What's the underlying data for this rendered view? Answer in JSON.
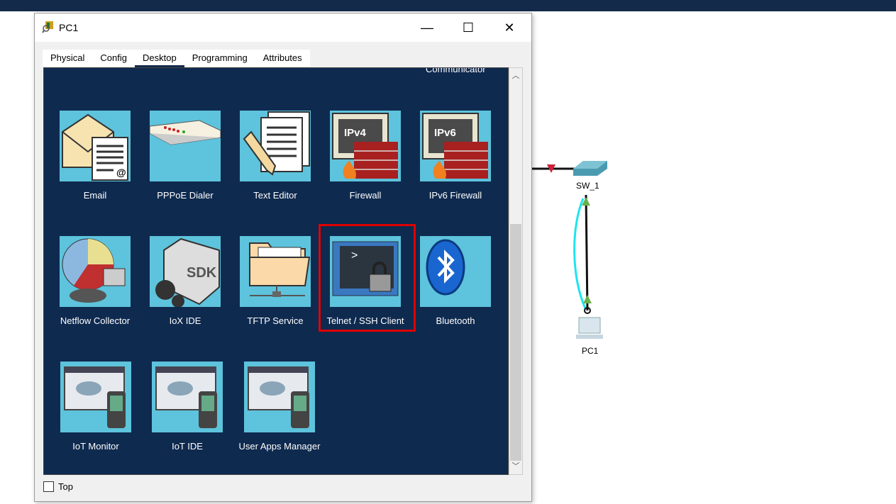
{
  "window": {
    "title": "PC1",
    "minimize": "—",
    "maximize": "☐",
    "close": "✕"
  },
  "tabs": [
    {
      "label": "Physical"
    },
    {
      "label": "Config"
    },
    {
      "label": "Desktop",
      "active": true
    },
    {
      "label": "Programming"
    },
    {
      "label": "Attributes"
    }
  ],
  "desktop": {
    "partial_label": "Communicator",
    "apps": [
      {
        "label": "Email",
        "icon": "email-icon"
      },
      {
        "label": "PPPoE Dialer",
        "icon": "modem-icon"
      },
      {
        "label": "Text Editor",
        "icon": "text-editor-icon"
      },
      {
        "label": "Firewall",
        "icon": "firewall-icon",
        "badge": "IPv4"
      },
      {
        "label": "IPv6 Firewall",
        "icon": "firewall-icon",
        "badge": "IPv6"
      },
      {
        "label": "Netflow Collector",
        "icon": "pie-chart-icon"
      },
      {
        "label": "IoX IDE",
        "icon": "sdk-icon",
        "badge": "SDK"
      },
      {
        "label": "TFTP Service",
        "icon": "folder-icon"
      },
      {
        "label": "Telnet / SSH Client",
        "icon": "terminal-lock-icon",
        "badge": ">",
        "highlighted": true
      },
      {
        "label": "Bluetooth",
        "icon": "bluetooth-icon"
      },
      {
        "label": "IoT Monitor",
        "icon": "cloud-phone-icon"
      },
      {
        "label": "IoT IDE",
        "icon": "cloud-phone-icon"
      },
      {
        "label": "User Apps Manager",
        "icon": "cloud-phone-icon"
      }
    ]
  },
  "top_checkbox": {
    "label": "Top",
    "checked": false
  },
  "topology": {
    "switch_label": "SW_1",
    "pc_label": "PC1"
  },
  "colors": {
    "desktop_bg": "#0f2a4f",
    "tile_bg": "#5ec3dc",
    "highlight": "#e00000",
    "link_cyan": "#1de5ef"
  }
}
